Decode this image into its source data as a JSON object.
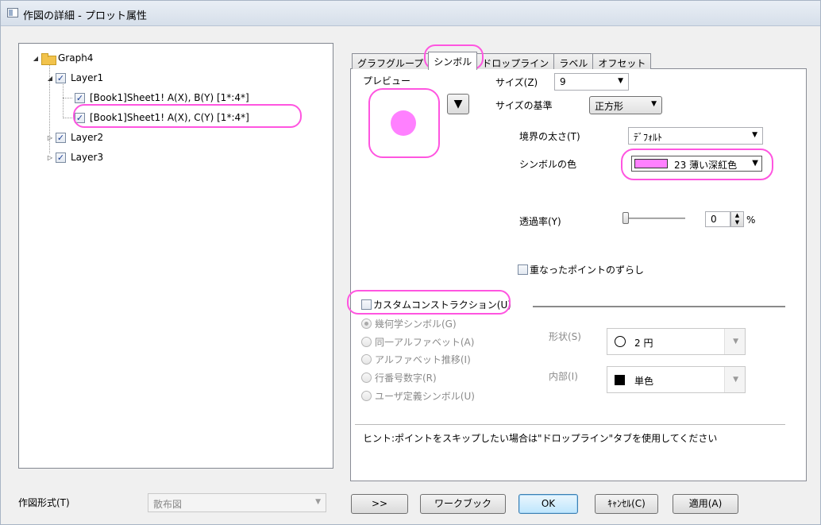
{
  "window": {
    "title": "作図の詳細 - プロット属性"
  },
  "tree": {
    "graph": "Graph4",
    "layer1": "Layer1",
    "plot1": "[Book1]Sheet1! A(X), B(Y) [1*:4*]",
    "plot2": "[Book1]Sheet1! A(X), C(Y) [1*:4*]",
    "layer2": "Layer2",
    "layer3": "Layer3"
  },
  "plot_type": {
    "label": "作図形式(T)",
    "value": "散布図"
  },
  "tabs": [
    "グラフグループ",
    "シンボル",
    "ドロップライン",
    "ラベル",
    "オフセット"
  ],
  "symbol": {
    "preview_label": "プレビュー",
    "preview_color": "#ff80ff",
    "size_label": "サイズ(Z)",
    "size_value": "9",
    "size_basis_label": "サイズの基準",
    "size_basis_value": "正方形",
    "edge_label": "境界の太さ(T)",
    "edge_value": "ﾃﾞﾌｫﾙﾄ",
    "color_label": "シンボルの色",
    "color_value": "23 薄い深紅色",
    "color_hex": "#ff80ff",
    "transparency_label": "透過率(Y)",
    "transparency_value": "0",
    "transparency_unit": "%",
    "offset_points_label": "重なったポイントのずらし",
    "custom_label": "カスタムコンストラクション(U)",
    "radio_options": [
      "幾何学シンボル(G)",
      "同一アルファベット(A)",
      "アルファベット推移(I)",
      "行番号数字(R)",
      "ユーザ定義シンボル(U)"
    ],
    "shape_label": "形状(S)",
    "shape_value": "2 円",
    "interior_label": "内部(I)",
    "interior_value": "単色",
    "hint": "ヒント:ポイントをスキップしたい場合は\"ドロップライン\"タブを使用してください"
  },
  "buttons": {
    "expand": ">>",
    "workbook": "ワークブック",
    "ok": "OK",
    "cancel": "ｷｬﾝｾﾙ(C)",
    "apply": "適用(A)"
  },
  "highlight_color": "#ff55e0"
}
